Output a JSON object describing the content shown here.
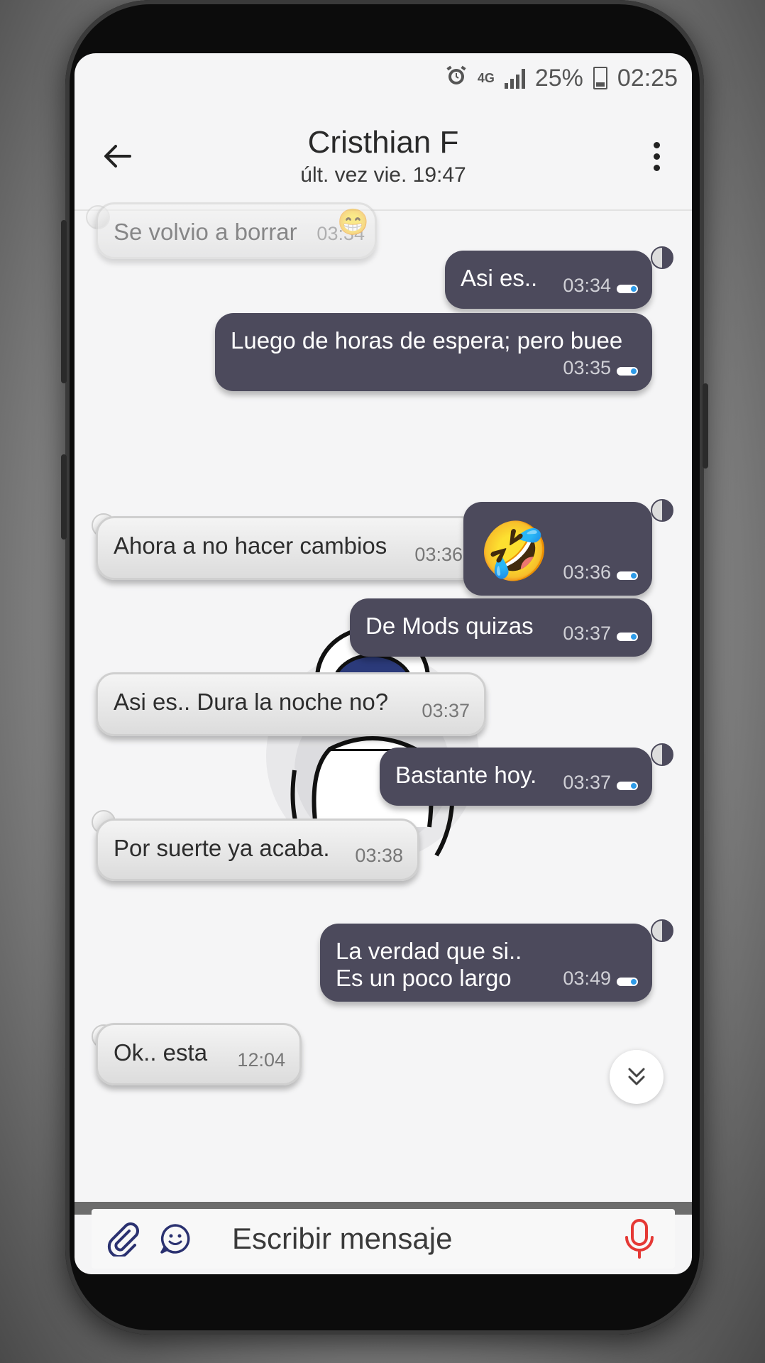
{
  "status_bar": {
    "network": "4G",
    "battery": "25%",
    "time": "02:25"
  },
  "header": {
    "contact_name": "Cristhian F",
    "last_seen": "últ. vez vie. 19:47"
  },
  "messages": [
    {
      "dir": "in",
      "text": "Se volvio a borrar",
      "time": "03:34",
      "emoji": "😁"
    },
    {
      "dir": "out",
      "text": "Asi es..",
      "time": "03:34"
    },
    {
      "dir": "out",
      "text": "Luego de horas de espera; pero buee",
      "time": "03:35"
    },
    {
      "dir": "in",
      "text": "Ahora a no hacer cambios",
      "time": "03:36"
    },
    {
      "dir": "out",
      "text": "🤣",
      "time": "03:36"
    },
    {
      "dir": "out",
      "text": "De Mods  quizas",
      "time": "03:37"
    },
    {
      "dir": "in",
      "text": "Asi es..  Dura la noche no?",
      "time": "03:37"
    },
    {
      "dir": "out",
      "text": "Bastante hoy.",
      "time": "03:37"
    },
    {
      "dir": "in",
      "text": "Por suerte ya acaba.",
      "time": "03:38"
    },
    {
      "dir": "out",
      "text_line1": "La verdad que si..",
      "text_line2": "Es un poco largo",
      "time": "03:49"
    },
    {
      "dir": "in",
      "text": "Ok.. esta",
      "time": "12:04"
    }
  ],
  "composer": {
    "placeholder": "Escribir mensaje"
  },
  "colors": {
    "outgoing_bubble": "#4c4a5c",
    "incoming_bubble": "#e6e6e6",
    "mic": "#e53935",
    "read_dot": "#2e9be8"
  },
  "icons": [
    "back-arrow-icon",
    "more-vert-icon",
    "attach-icon",
    "emoji-icon",
    "mic-icon",
    "chevron-double-down-icon",
    "alarm-icon"
  ]
}
